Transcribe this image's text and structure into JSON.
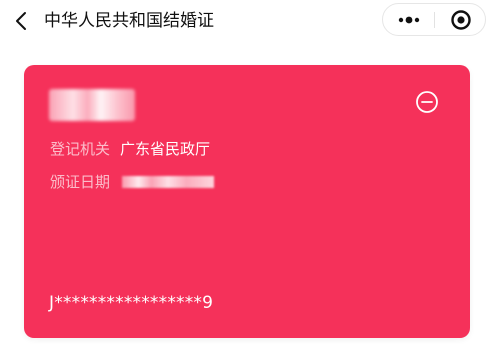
{
  "navbar": {
    "title": "中华人民共和国结婚证",
    "back_icon": "chevron-left-icon",
    "more_icon": "more-dots-icon",
    "close_icon": "target-circle-icon"
  },
  "card": {
    "background_color": "#f5315a",
    "collapse_icon": "minus-circle-icon",
    "authority_label": "登记机关",
    "authority_value": "广东省民政厅",
    "issue_date_label": "颁证日期",
    "certificate_number": "J*****************9"
  }
}
